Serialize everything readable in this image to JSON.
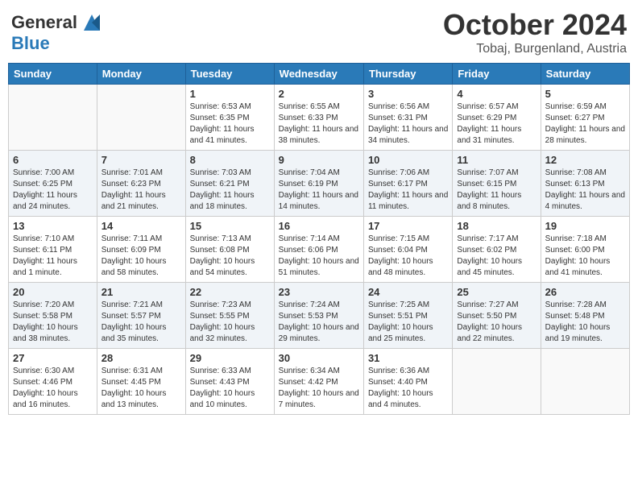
{
  "header": {
    "logo_line1": "General",
    "logo_line2": "Blue",
    "month": "October 2024",
    "location": "Tobaj, Burgenland, Austria"
  },
  "weekdays": [
    "Sunday",
    "Monday",
    "Tuesday",
    "Wednesday",
    "Thursday",
    "Friday",
    "Saturday"
  ],
  "weeks": [
    [
      {
        "day": "",
        "info": ""
      },
      {
        "day": "",
        "info": ""
      },
      {
        "day": "1",
        "info": "Sunrise: 6:53 AM\nSunset: 6:35 PM\nDaylight: 11 hours and 41 minutes."
      },
      {
        "day": "2",
        "info": "Sunrise: 6:55 AM\nSunset: 6:33 PM\nDaylight: 11 hours and 38 minutes."
      },
      {
        "day": "3",
        "info": "Sunrise: 6:56 AM\nSunset: 6:31 PM\nDaylight: 11 hours and 34 minutes."
      },
      {
        "day": "4",
        "info": "Sunrise: 6:57 AM\nSunset: 6:29 PM\nDaylight: 11 hours and 31 minutes."
      },
      {
        "day": "5",
        "info": "Sunrise: 6:59 AM\nSunset: 6:27 PM\nDaylight: 11 hours and 28 minutes."
      }
    ],
    [
      {
        "day": "6",
        "info": "Sunrise: 7:00 AM\nSunset: 6:25 PM\nDaylight: 11 hours and 24 minutes."
      },
      {
        "day": "7",
        "info": "Sunrise: 7:01 AM\nSunset: 6:23 PM\nDaylight: 11 hours and 21 minutes."
      },
      {
        "day": "8",
        "info": "Sunrise: 7:03 AM\nSunset: 6:21 PM\nDaylight: 11 hours and 18 minutes."
      },
      {
        "day": "9",
        "info": "Sunrise: 7:04 AM\nSunset: 6:19 PM\nDaylight: 11 hours and 14 minutes."
      },
      {
        "day": "10",
        "info": "Sunrise: 7:06 AM\nSunset: 6:17 PM\nDaylight: 11 hours and 11 minutes."
      },
      {
        "day": "11",
        "info": "Sunrise: 7:07 AM\nSunset: 6:15 PM\nDaylight: 11 hours and 8 minutes."
      },
      {
        "day": "12",
        "info": "Sunrise: 7:08 AM\nSunset: 6:13 PM\nDaylight: 11 hours and 4 minutes."
      }
    ],
    [
      {
        "day": "13",
        "info": "Sunrise: 7:10 AM\nSunset: 6:11 PM\nDaylight: 11 hours and 1 minute."
      },
      {
        "day": "14",
        "info": "Sunrise: 7:11 AM\nSunset: 6:09 PM\nDaylight: 10 hours and 58 minutes."
      },
      {
        "day": "15",
        "info": "Sunrise: 7:13 AM\nSunset: 6:08 PM\nDaylight: 10 hours and 54 minutes."
      },
      {
        "day": "16",
        "info": "Sunrise: 7:14 AM\nSunset: 6:06 PM\nDaylight: 10 hours and 51 minutes."
      },
      {
        "day": "17",
        "info": "Sunrise: 7:15 AM\nSunset: 6:04 PM\nDaylight: 10 hours and 48 minutes."
      },
      {
        "day": "18",
        "info": "Sunrise: 7:17 AM\nSunset: 6:02 PM\nDaylight: 10 hours and 45 minutes."
      },
      {
        "day": "19",
        "info": "Sunrise: 7:18 AM\nSunset: 6:00 PM\nDaylight: 10 hours and 41 minutes."
      }
    ],
    [
      {
        "day": "20",
        "info": "Sunrise: 7:20 AM\nSunset: 5:58 PM\nDaylight: 10 hours and 38 minutes."
      },
      {
        "day": "21",
        "info": "Sunrise: 7:21 AM\nSunset: 5:57 PM\nDaylight: 10 hours and 35 minutes."
      },
      {
        "day": "22",
        "info": "Sunrise: 7:23 AM\nSunset: 5:55 PM\nDaylight: 10 hours and 32 minutes."
      },
      {
        "day": "23",
        "info": "Sunrise: 7:24 AM\nSunset: 5:53 PM\nDaylight: 10 hours and 29 minutes."
      },
      {
        "day": "24",
        "info": "Sunrise: 7:25 AM\nSunset: 5:51 PM\nDaylight: 10 hours and 25 minutes."
      },
      {
        "day": "25",
        "info": "Sunrise: 7:27 AM\nSunset: 5:50 PM\nDaylight: 10 hours and 22 minutes."
      },
      {
        "day": "26",
        "info": "Sunrise: 7:28 AM\nSunset: 5:48 PM\nDaylight: 10 hours and 19 minutes."
      }
    ],
    [
      {
        "day": "27",
        "info": "Sunrise: 6:30 AM\nSunset: 4:46 PM\nDaylight: 10 hours and 16 minutes."
      },
      {
        "day": "28",
        "info": "Sunrise: 6:31 AM\nSunset: 4:45 PM\nDaylight: 10 hours and 13 minutes."
      },
      {
        "day": "29",
        "info": "Sunrise: 6:33 AM\nSunset: 4:43 PM\nDaylight: 10 hours and 10 minutes."
      },
      {
        "day": "30",
        "info": "Sunrise: 6:34 AM\nSunset: 4:42 PM\nDaylight: 10 hours and 7 minutes."
      },
      {
        "day": "31",
        "info": "Sunrise: 6:36 AM\nSunset: 4:40 PM\nDaylight: 10 hours and 4 minutes."
      },
      {
        "day": "",
        "info": ""
      },
      {
        "day": "",
        "info": ""
      }
    ]
  ]
}
